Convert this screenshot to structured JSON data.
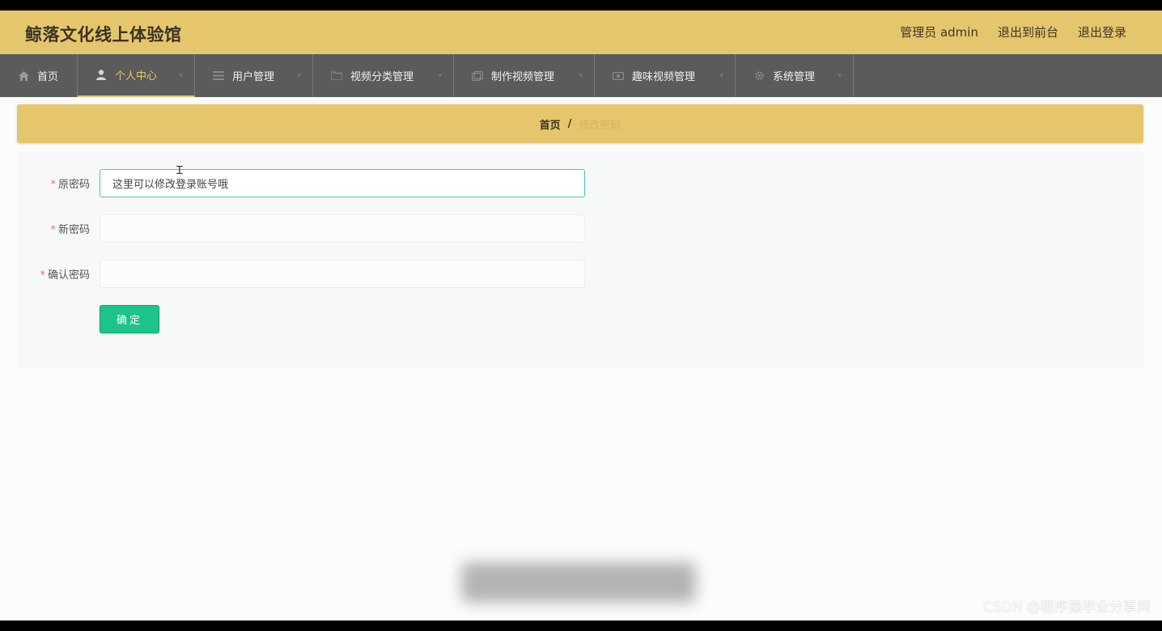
{
  "header": {
    "title": "鲸落文化线上体验馆",
    "admin_label": "管理员 admin",
    "front_link": "退出到前台",
    "logout_link": "退出登录"
  },
  "nav": {
    "items": [
      {
        "label": "首页",
        "icon": "home-icon"
      },
      {
        "label": "个人中心",
        "icon": "user-icon",
        "active": true
      },
      {
        "label": "用户管理",
        "icon": "list-icon"
      },
      {
        "label": "视频分类管理",
        "icon": "folder-icon"
      },
      {
        "label": "制作视频管理",
        "icon": "video-icon"
      },
      {
        "label": "趣味视频管理",
        "icon": "film-icon"
      },
      {
        "label": "系统管理",
        "icon": "gear-icon"
      }
    ]
  },
  "breadcrumb": {
    "home": "首页",
    "separator": "/",
    "current": "修改密码"
  },
  "form": {
    "old_password": {
      "label": "原密码",
      "value": "这里可以修改登录账号哦"
    },
    "new_password": {
      "label": "新密码",
      "value": ""
    },
    "confirm_password": {
      "label": "确认密码",
      "value": ""
    },
    "required_mark": "*",
    "submit_label": "确定"
  },
  "watermark": "CSDN @程序猿毕业分享网",
  "colors": {
    "header_bg": "#e6c66c",
    "nav_bg": "#5b5b5b",
    "accent": "#e6c66c",
    "button": "#1ec38c",
    "focus_border": "#4fc3b2"
  }
}
